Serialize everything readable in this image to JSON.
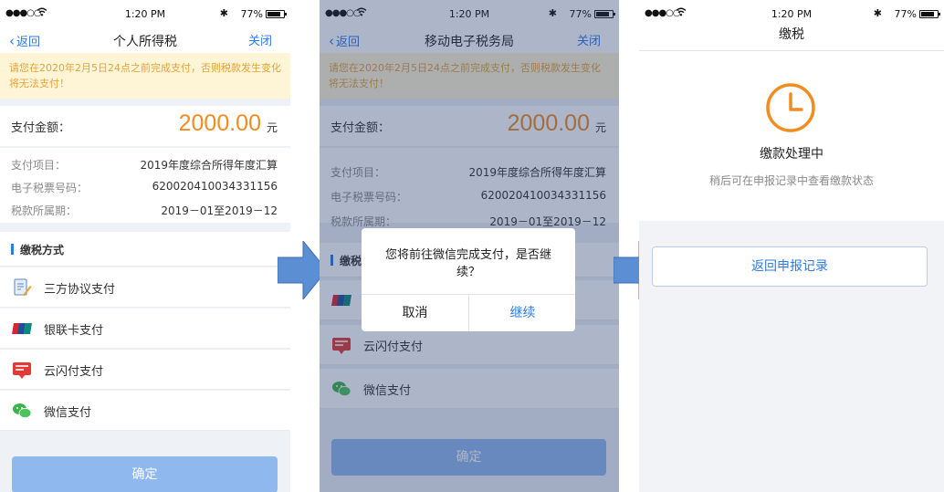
{
  "status_bar": {
    "time": "1:20 PM",
    "battery": "77%"
  },
  "screen1": {
    "nav": {
      "back": "返回",
      "title": "个人所得税",
      "close": "关闭"
    },
    "notice": "请您在2020年2月5日24点之前完成支付，否则税款发生变化将无法支付！",
    "amount": {
      "label": "支付金额：",
      "value": "2000.00",
      "unit": "元"
    },
    "details": [
      {
        "key": "支付项目：",
        "value": "2019年度综合所得年度汇算"
      },
      {
        "key": "电子税票号码：",
        "value": "620020410034331156"
      },
      {
        "key": "税款所属期：",
        "value": "2019－01至2019－12"
      }
    ],
    "section_title": "缴税方式",
    "payment_methods": [
      {
        "label": "三方协议支付",
        "icon": "agreement-icon"
      },
      {
        "label": "银联卡支付",
        "icon": "unionpay-icon"
      },
      {
        "label": "云闪付支付",
        "icon": "quickpass-icon"
      },
      {
        "label": "微信支付",
        "icon": "wechat-icon"
      }
    ],
    "confirm": "确定"
  },
  "screen2": {
    "nav": {
      "back": "返回",
      "title": "移动电子税务局",
      "close": "关闭"
    },
    "notice": "请您在2020年2月5日24点之前完成支付，否则税款发生变化将无法支付！",
    "amount": {
      "label": "支付金额：",
      "value": "2000.00",
      "unit": "元"
    },
    "details": [
      {
        "key": "支付项目：",
        "value": "2019年度综合所得年度汇算"
      },
      {
        "key": "电子税票号码：",
        "value": "620020410034331156"
      },
      {
        "key": "税款所属期：",
        "value": "2019－01至2019－12"
      }
    ],
    "section_title": "缴税",
    "payment_methods": [
      {
        "label": "",
        "icon": "unionpay-icon"
      },
      {
        "label": "云闪付支付",
        "icon": "quickpass-icon"
      },
      {
        "label": "微信支付",
        "icon": "wechat-icon"
      }
    ],
    "confirm": "确定",
    "dialog": {
      "message": "您将前往微信完成支付，是否继续？",
      "cancel": "取消",
      "continue": "继续"
    }
  },
  "screen3": {
    "title": "缴税",
    "status": "缴款处理中",
    "hint": "稍后可在申报记录中查看缴款状态",
    "button": "返回申报记录"
  },
  "colors": {
    "accent": "#2d7be3",
    "amount": "#f08c20",
    "notice_bg": "#fdf5d5",
    "notice_text": "#e6a23c",
    "arrow": "#5b8ed2"
  }
}
